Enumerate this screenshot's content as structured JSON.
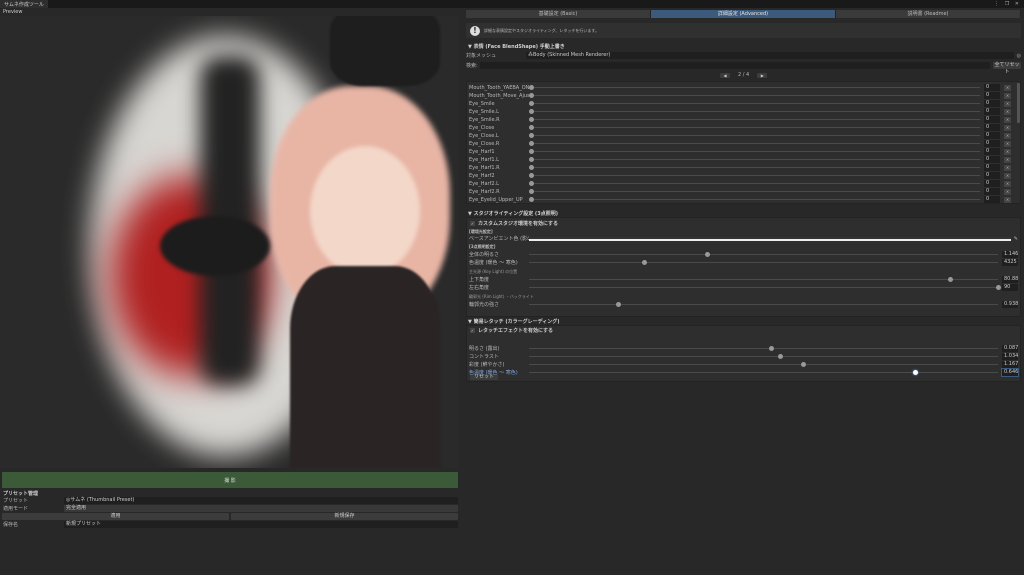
{
  "window": {
    "tab_title": "サムネ作成ツール",
    "controls": "⋮ ❐ ✕",
    "preview_label": "Preview"
  },
  "left": {
    "shoot_button": "撮 影",
    "preset_section": "プリセット管理",
    "preset_label": "プリセット",
    "preset_value": "◎サムネ (Thumbnail Preset)",
    "mode_label": "適用モード",
    "mode_value": "完全適用",
    "apply_button": "適用",
    "save_new_button": "新規保存",
    "save_name_label": "保存名",
    "save_name_value": "新規プリセット"
  },
  "tabs": [
    {
      "label": "基礎設定 (Basic)",
      "active": false
    },
    {
      "label": "詳細設定 (Advanced)",
      "active": true
    },
    {
      "label": "説明書 (Readme)",
      "active": false
    }
  ],
  "help_text": "詳細な表情設定やスタジオライティング、レタッチを行います。",
  "face": {
    "header": "表情 (Face BlendShape) 手動上書き",
    "mesh_label": "対象メッシュ",
    "mesh_value": "⁂Body (Skinned Mesh Renderer)",
    "search_label": "検索:",
    "reset_all": "全てリセット",
    "page": "2 / 4",
    "prev": "◀",
    "next": "▶",
    "shapes": [
      {
        "name": "Mouth_Tooth_YAEBA_ON",
        "value": "0"
      },
      {
        "name": "Mouth_Tooth_Move_Ajust",
        "value": "0"
      },
      {
        "name": "Eye_Smile",
        "value": "0"
      },
      {
        "name": "Eye_Smile.L",
        "value": "0"
      },
      {
        "name": "Eye_Smile.R",
        "value": "0"
      },
      {
        "name": "Eye_Close",
        "value": "0"
      },
      {
        "name": "Eye_Close.L",
        "value": "0"
      },
      {
        "name": "Eye_Close.R",
        "value": "0"
      },
      {
        "name": "Eye_Harf1",
        "value": "0"
      },
      {
        "name": "Eye_Harf1.L",
        "value": "0"
      },
      {
        "name": "Eye_Harf1.R",
        "value": "0"
      },
      {
        "name": "Eye_Harf2",
        "value": "0"
      },
      {
        "name": "Eye_Harf2.L",
        "value": "0"
      },
      {
        "name": "Eye_Harf2.R",
        "value": "0"
      },
      {
        "name": "Eye_Eyelid_Upper_UP",
        "value": "0"
      }
    ],
    "reset_glyph": "×"
  },
  "studio": {
    "header": "スタジオライティング設定 (3点照明)",
    "enable": "カスタムスタジオ環境を有効にする",
    "check": "✓",
    "env_label": "[環境光設定]",
    "ambient_label": "ベースアンビエント色 (影の色)",
    "three_label": "[3点照明設定]",
    "keylight_label": "主光源 (Key Light) の位置",
    "rim_label": "輪郭光 (Rim Light) ・バックライト",
    "brightness": {
      "label": "全体の明るさ",
      "value": "1.146",
      "position": 0.38
    },
    "temp": {
      "label": "色温度 (暖色 ～ 寒色)",
      "value": "4325",
      "position": 0.245
    },
    "updown": {
      "label": "上下角度",
      "value": "80.88",
      "position": 0.898
    },
    "leftright": {
      "label": "左右角度",
      "value": "90",
      "position": 1.0
    },
    "rim": {
      "label": "輪郭光の強さ",
      "value": "0.938",
      "position": 0.19
    }
  },
  "retouch": {
    "header": "簡易レタッチ (カラーグレーディング)",
    "enable": "レタッチエフェクトを有効にする",
    "check": "✓",
    "reset_button": "リセット",
    "sliders": [
      {
        "label": "明るさ (露出)",
        "value": "0.087",
        "position": 0.515
      },
      {
        "label": "コントラスト",
        "value": "1.034",
        "position": 0.535
      },
      {
        "label": "彩度 (鮮やかさ)",
        "value": "1.167",
        "position": 0.584
      },
      {
        "label": "色温度 (暖色 ～ 寒色)",
        "value": "0.646",
        "position": 0.823,
        "active": true
      }
    ]
  },
  "colors": {
    "accent": "#3c5a7c",
    "shoot": "#3b5a37",
    "active_label": "#7fa3d6"
  }
}
